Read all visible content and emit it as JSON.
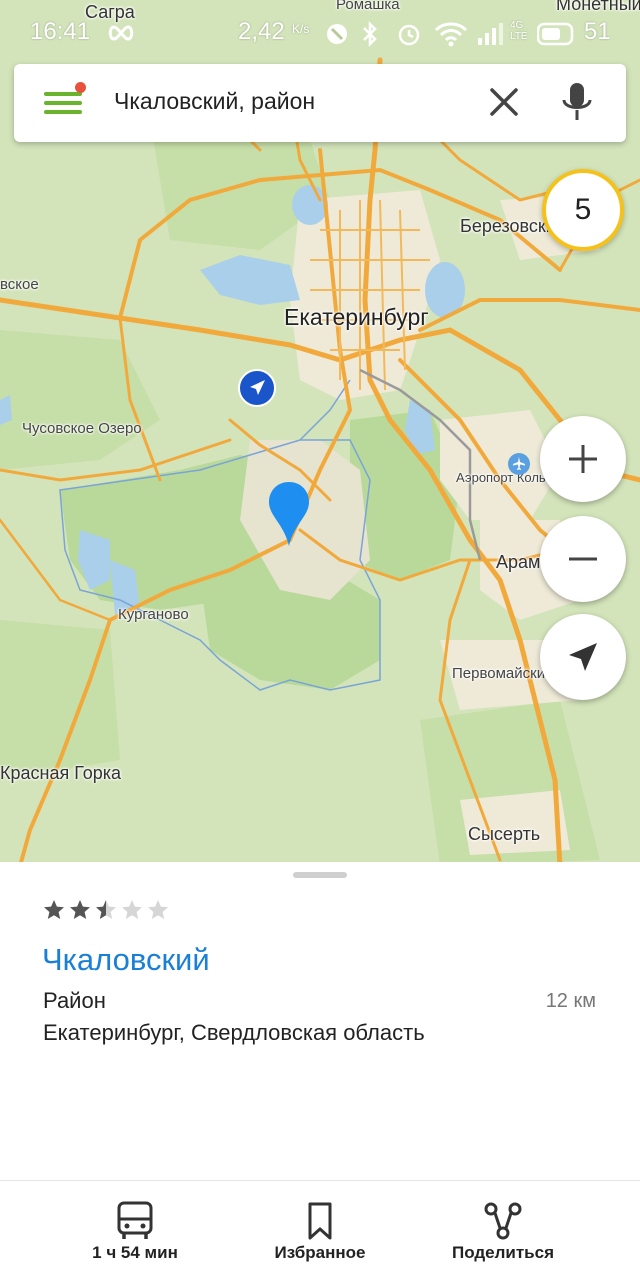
{
  "status_bar": {
    "time": "16:41",
    "speed": "2,42",
    "speed_unit": "K/s",
    "network": "4G LTE",
    "battery": "51"
  },
  "search": {
    "query": "Чкаловский, район"
  },
  "map": {
    "traffic_level": "5",
    "labels": {
      "yekaterinburg": "Екатеринбург",
      "berezovsky": "Березовский",
      "chusovskoe": "Чусовское Озеро",
      "kurganovo": "Курганово",
      "airport": "Аэропорт Кольцово",
      "aramil": "Арамиль",
      "pervomaisky": "Первомайский",
      "krasnaya_gorka": "Красная Горка",
      "sysert": "Сысерть",
      "sagra": "Сагра",
      "romashka": "Ромашка",
      "monetny": "Монетный",
      "west_village": "вское"
    }
  },
  "place": {
    "rating": 2.5,
    "rating_max": 5,
    "title": "Чкаловский",
    "type": "Район",
    "distance": "12 км",
    "address": "Екатеринбург, Свердловская область"
  },
  "bottom_nav": {
    "transit_label": "1 ч 54 мин",
    "favorites_label": "Избранное",
    "share_label": "Поделиться"
  },
  "colors": {
    "accent_blue": "#1a7fd6",
    "menu_green": "#6ab42d",
    "notification_red": "#e8523d",
    "traffic_yellow": "#f4c21b",
    "road_orange": "#f2a93b",
    "water": "#a9cfea",
    "forest": "#b9d99a",
    "urban": "#efead8"
  },
  "icons": {
    "menu": "menu-icon",
    "clear": "close-icon",
    "mic": "microphone-icon",
    "zoom_in": "plus-icon",
    "zoom_out": "minus-icon",
    "locate": "navigation-arrow-icon",
    "user_location": "location-arrow-icon",
    "pin": "map-pin-icon",
    "airport": "airplane-icon",
    "transit": "bus-icon",
    "favorites": "bookmark-icon",
    "share": "share-icon"
  }
}
